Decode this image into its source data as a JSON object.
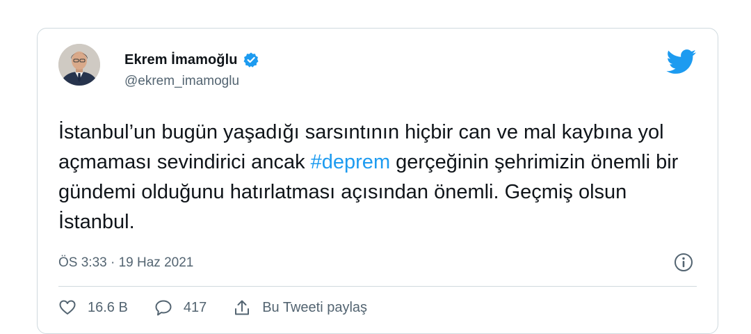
{
  "tweet": {
    "author": {
      "name": "Ekrem İmamoğlu",
      "handle": "@ekrem_imamoglu",
      "avatar": "profile-photo",
      "verified": true
    },
    "text_before": "İstanbul’un bugün yaşadığı sarsıntının hiçbir can ve mal kaybına yol açmaması sevindirici ancak ",
    "hashtag": "#deprem",
    "text_after": " gerçeğinin şehrimizin önemli bir gündemi olduğunu hatırlatması açısından önemli. Geçmiş olsun İstanbul.",
    "timestamp": "ÖS 3:33 · 19 Haz 2021",
    "actions": {
      "like_count": "16.6 B",
      "reply_count": "417",
      "share_label": "Bu Tweeti paylaş"
    },
    "icons": {
      "brand": "twitter-bird-icon",
      "verified": "verified-badge-icon",
      "info": "info-icon",
      "like": "heart-icon",
      "reply": "reply-icon",
      "share": "share-icon"
    },
    "colors": {
      "brand": "#1d9bf0",
      "text": "#0f1419",
      "muted": "#536471",
      "border": "#cfd9de"
    }
  }
}
